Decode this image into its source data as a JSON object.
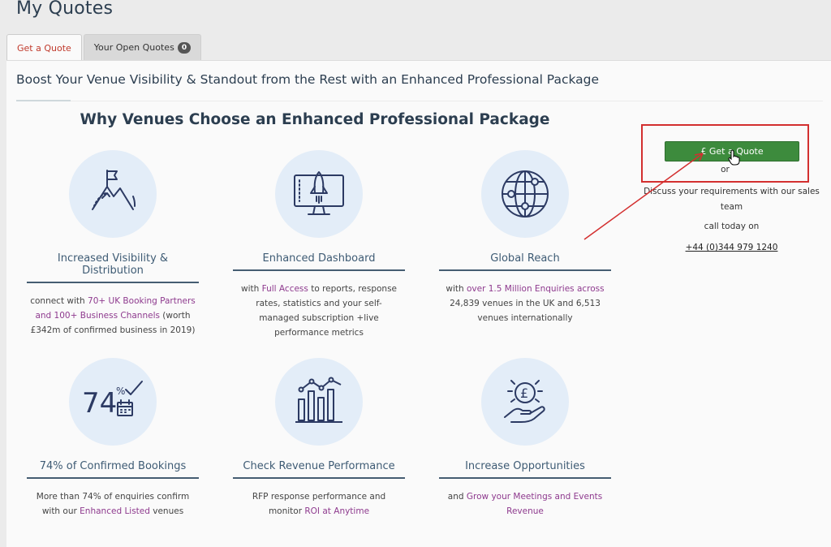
{
  "page": {
    "title": "My Quotes"
  },
  "tabs": [
    {
      "label": "Get a Quote",
      "active": true
    },
    {
      "label": "Your Open Quotes",
      "badge": "0",
      "active": false
    }
  ],
  "headline": "Boost Your Venue Visibility & Standout from the Rest with an Enhanced Professional Package",
  "section_title": "Why Venues Choose an Enhanced Professional Package",
  "features": [
    {
      "icon": "mountain-flag-icon",
      "title": "Increased Visibility & Distribution",
      "desc": [
        {
          "text": "connect with ",
          "hl": false
        },
        {
          "text": "70+ UK Booking Partners and 100+ Business Channels",
          "hl": true
        },
        {
          "text": " (worth £342m of confirmed business in 2019)",
          "hl": false
        }
      ]
    },
    {
      "icon": "rocket-monitor-icon",
      "title": "Enhanced Dashboard",
      "desc": [
        {
          "text": "with ",
          "hl": false
        },
        {
          "text": "Full Access",
          "hl": true
        },
        {
          "text": " to reports, response rates, statistics and your self-managed subscription +live performance metrics",
          "hl": false
        }
      ]
    },
    {
      "icon": "globe-icon",
      "title": "Global Reach",
      "desc": [
        {
          "text": "with ",
          "hl": false
        },
        {
          "text": "over 1.5 Million Enquiries across",
          "hl": true
        },
        {
          "text": " 24,839 venues in the UK and 6,513 venues internationally",
          "hl": false
        }
      ]
    },
    {
      "icon": "percent-calendar-icon",
      "icon_text": {
        "number": "74",
        "symbol": "%"
      },
      "title": "74% of Confirmed Bookings",
      "desc": [
        {
          "text": "More than 74% of enquiries confirm with our ",
          "hl": false
        },
        {
          "text": "Enhanced Listed",
          "hl": true
        },
        {
          "text": " venues",
          "hl": false
        }
      ]
    },
    {
      "icon": "bar-chart-icon",
      "title": "Check Revenue Performance",
      "desc": [
        {
          "text": "RFP response performance and monitor ",
          "hl": false
        },
        {
          "text": "ROI at Anytime",
          "hl": true
        }
      ]
    },
    {
      "icon": "pound-hand-icon",
      "title": "Increase Opportunities",
      "desc": [
        {
          "text": "and ",
          "hl": false
        },
        {
          "text": "Grow your Meetings and Events Revenue",
          "hl": true
        }
      ]
    }
  ],
  "cta": {
    "button_label": "£ Get a Quote",
    "or": "or",
    "discuss": "Discuss your requirements with our sales team",
    "call": "call today on",
    "phone": "+44 (0)344 979 1240"
  },
  "colors": {
    "accent_red": "#c0392b",
    "cta_green": "#3d8b3d",
    "highlight_purple": "#8e3a8e",
    "heading_navy": "#2c3e50"
  }
}
